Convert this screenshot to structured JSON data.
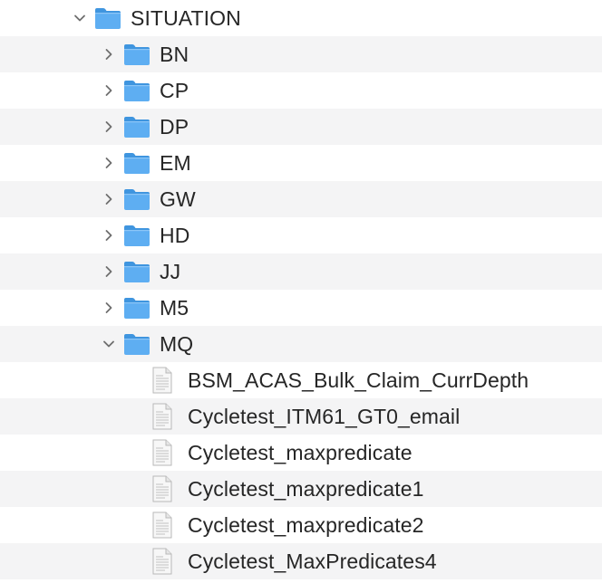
{
  "tree": {
    "root": {
      "label": "SITUATION",
      "expanded": true,
      "icon": "folder-icon"
    },
    "folders": [
      {
        "label": "BN",
        "expanded": false,
        "icon": "folder-icon"
      },
      {
        "label": "CP",
        "expanded": false,
        "icon": "folder-icon"
      },
      {
        "label": "DP",
        "expanded": false,
        "icon": "folder-icon"
      },
      {
        "label": "EM",
        "expanded": false,
        "icon": "folder-icon"
      },
      {
        "label": "GW",
        "expanded": false,
        "icon": "folder-icon"
      },
      {
        "label": "HD",
        "expanded": false,
        "icon": "folder-icon"
      },
      {
        "label": "JJ",
        "expanded": false,
        "icon": "folder-icon"
      },
      {
        "label": "M5",
        "expanded": false,
        "icon": "folder-icon"
      },
      {
        "label": "MQ",
        "expanded": true,
        "icon": "folder-icon"
      }
    ],
    "files": [
      {
        "label": "BSM_ACAS_Bulk_Claim_CurrDepth",
        "icon": "document-icon"
      },
      {
        "label": "Cycletest_ITM61_GT0_email",
        "icon": "document-icon"
      },
      {
        "label": "Cycletest_maxpredicate",
        "icon": "document-icon"
      },
      {
        "label": "Cycletest_maxpredicate1",
        "icon": "document-icon"
      },
      {
        "label": "Cycletest_maxpredicate2",
        "icon": "document-icon"
      },
      {
        "label": "Cycletest_MaxPredicates4",
        "icon": "document-icon"
      }
    ]
  },
  "colors": {
    "row_alt": "#f4f4f5",
    "folder_front": "#5eaef2",
    "folder_back": "#3f95df",
    "text": "#262626",
    "chevron": "#6e6e6e"
  }
}
